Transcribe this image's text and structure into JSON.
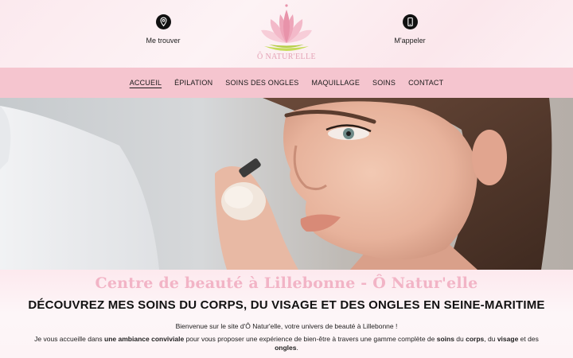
{
  "header": {
    "find_us": {
      "label": "Me trouver",
      "icon": "location-pin-icon"
    },
    "call_us": {
      "label": "M'appeler",
      "icon": "phone-icon"
    },
    "logo_text": "Ô NATUR'ELLE"
  },
  "nav": {
    "items": [
      {
        "label": "ACCUEIL",
        "active": true
      },
      {
        "label": "ÉPILATION"
      },
      {
        "label": "SOINS DES ONGLES"
      },
      {
        "label": "MAQUILLAGE"
      },
      {
        "label": "SOINS"
      },
      {
        "label": "CONTACT"
      }
    ]
  },
  "hero": {
    "image": "woman-makeup-brush-photo"
  },
  "content": {
    "title": "Centre de beauté à Lillebonne - Ô Natur'elle",
    "subtitle": "DÉCOUVREZ MES SOINS DU CORPS, DU VISAGE ET DES ONGLES EN SEINE-MARITIME",
    "intro": "Bienvenue sur le site d'Ô Natur'elle, votre univers de beauté à Lillebonne !",
    "para": {
      "t1": "Je vous accueille dans ",
      "b1": "une ambiance conviviale",
      "t2": " pour vous proposer une expérience de bien-être à travers une gamme complète de ",
      "b2": "soins",
      "t3": " du ",
      "b3": "corps",
      "t4": ", du ",
      "b4": "visage",
      "t5": " et des ",
      "b5": "ongles",
      "t6": "."
    }
  },
  "colors": {
    "nav_bg": "#f5c5cf",
    "title_pink": "#f2b4c6",
    "logo_pink": "#e4a3b6",
    "logo_green": "#c6dc5a"
  }
}
